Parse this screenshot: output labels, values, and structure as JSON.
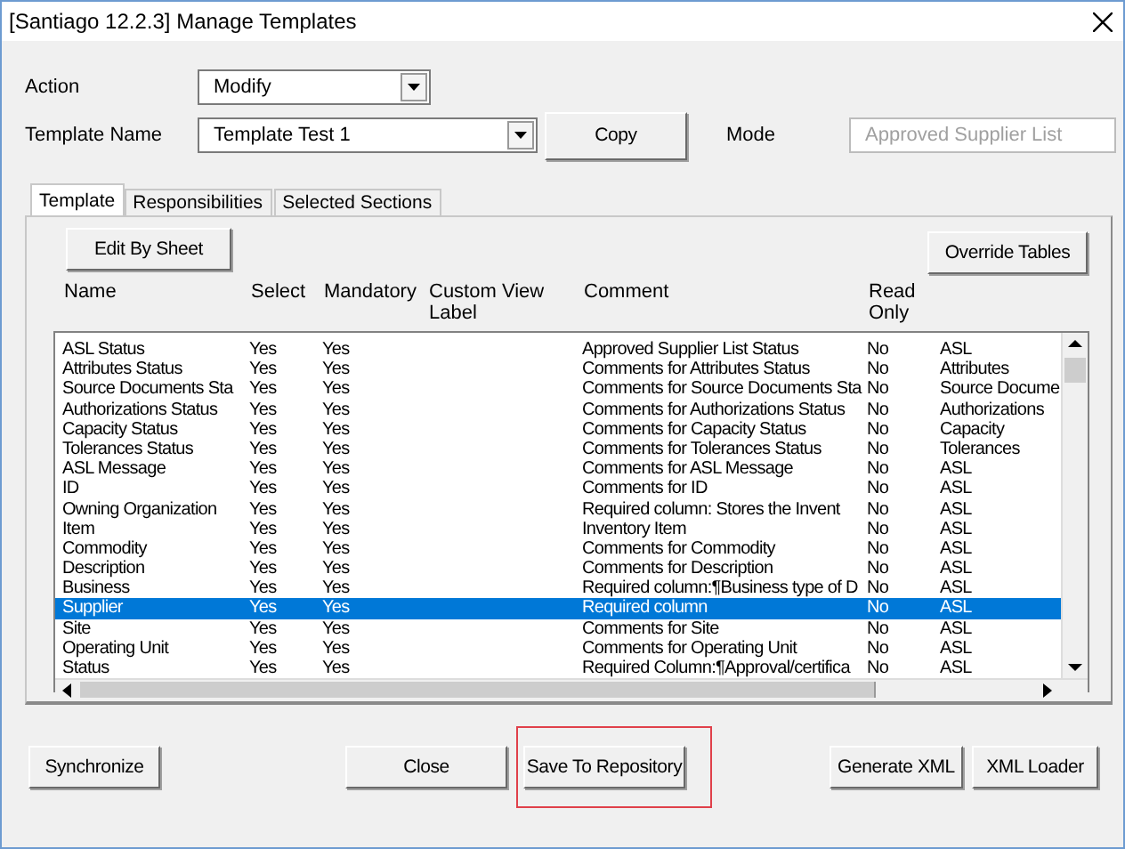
{
  "window": {
    "title": "[Santiago 12.2.3] Manage Templates"
  },
  "action": {
    "label": "Action",
    "value": "Modify"
  },
  "template_name": {
    "label": "Template Name",
    "value": "Template Test 1"
  },
  "copy_button": "Copy",
  "mode": {
    "label": "Mode",
    "value": "Approved Supplier List",
    "disabled": true
  },
  "tabs": [
    {
      "label": "Template",
      "selected": true
    },
    {
      "label": "Responsibilities",
      "selected": false
    },
    {
      "label": "Selected Sections",
      "selected": false
    }
  ],
  "edit_by_sheet_button": "Edit By Sheet",
  "override_tables_button": "Override Tables",
  "table": {
    "columns": [
      "Name",
      "Select",
      "Mandatory",
      "Custom View Label",
      "Comment",
      "Read Only"
    ],
    "rows": [
      {
        "name": "ASL Status",
        "select": "Yes",
        "mandatory": "Yes",
        "comment": "Approved Supplier List Status",
        "read_only": "No",
        "column_7": "ASL",
        "selected": false
      },
      {
        "name": "Attributes Status",
        "select": "Yes",
        "mandatory": "Yes",
        "comment": "Comments for Attributes Status",
        "read_only": "No",
        "column_7": "Attributes",
        "selected": false
      },
      {
        "name": "Source Documents Sta",
        "select": "Yes",
        "mandatory": "Yes",
        "comment": "Comments for Source Documents Sta",
        "read_only": "No",
        "column_7": "Source Docume",
        "selected": false
      },
      {
        "name": "Authorizations Status",
        "select": "Yes",
        "mandatory": "Yes",
        "comment": "Comments for Authorizations Status",
        "read_only": "No",
        "column_7": "Authorizations",
        "selected": false
      },
      {
        "name": "Capacity Status",
        "select": "Yes",
        "mandatory": "Yes",
        "comment": "Comments for Capacity Status",
        "read_only": "No",
        "column_7": "Capacity",
        "selected": false
      },
      {
        "name": "Tolerances Status",
        "select": "Yes",
        "mandatory": "Yes",
        "comment": "Comments for Tolerances Status",
        "read_only": "No",
        "column_7": "Tolerances",
        "selected": false
      },
      {
        "name": "ASL Message",
        "select": "Yes",
        "mandatory": "Yes",
        "comment": "Comments for ASL Message",
        "read_only": "No",
        "column_7": "ASL",
        "selected": false
      },
      {
        "name": "ID",
        "select": "Yes",
        "mandatory": "Yes",
        "comment": "Comments for ID",
        "read_only": "No",
        "column_7": "ASL",
        "selected": false
      },
      {
        "name": "Owning Organization",
        "select": "Yes",
        "mandatory": "Yes",
        "comment": "Required column:  Stores the Invent",
        "read_only": "No",
        "column_7": "ASL",
        "selected": false
      },
      {
        "name": "Item",
        "select": "Yes",
        "mandatory": "Yes",
        "comment": "Inventory Item",
        "read_only": "No",
        "column_7": "ASL",
        "selected": false
      },
      {
        "name": "Commodity",
        "select": "Yes",
        "mandatory": "Yes",
        "comment": "Comments for Commodity",
        "read_only": "No",
        "column_7": "ASL",
        "selected": false
      },
      {
        "name": "Description",
        "select": "Yes",
        "mandatory": "Yes",
        "comment": "Comments for Description",
        "read_only": "No",
        "column_7": "ASL",
        "selected": false
      },
      {
        "name": "Business",
        "select": "Yes",
        "mandatory": "Yes",
        "comment": "Required column:¶Business type of D",
        "read_only": "No",
        "column_7": "ASL",
        "selected": false
      },
      {
        "name": "Supplier",
        "select": "Yes",
        "mandatory": "Yes",
        "comment": "Required column",
        "read_only": "No",
        "column_7": "ASL",
        "selected": true
      },
      {
        "name": "Site",
        "select": "Yes",
        "mandatory": "Yes",
        "comment": "Comments for Site",
        "read_only": "No",
        "column_7": "ASL",
        "selected": false
      },
      {
        "name": "Operating Unit",
        "select": "Yes",
        "mandatory": "Yes",
        "comment": "Comments for Operating Unit",
        "read_only": "No",
        "column_7": "ASL",
        "selected": false
      },
      {
        "name": "Status",
        "select": "Yes",
        "mandatory": "Yes",
        "comment": "Required Column:¶Approval/certifica",
        "read_only": "No",
        "column_7": "ASL",
        "selected": false
      }
    ]
  },
  "footer_buttons": [
    {
      "label": "Synchronize",
      "highlighted": false
    },
    {
      "label": "Close",
      "highlighted": false
    },
    {
      "label": "Save To Repository",
      "highlighted": true
    },
    {
      "label": "Generate XML",
      "highlighted": false
    },
    {
      "label": "XML Loader",
      "highlighted": false
    }
  ]
}
